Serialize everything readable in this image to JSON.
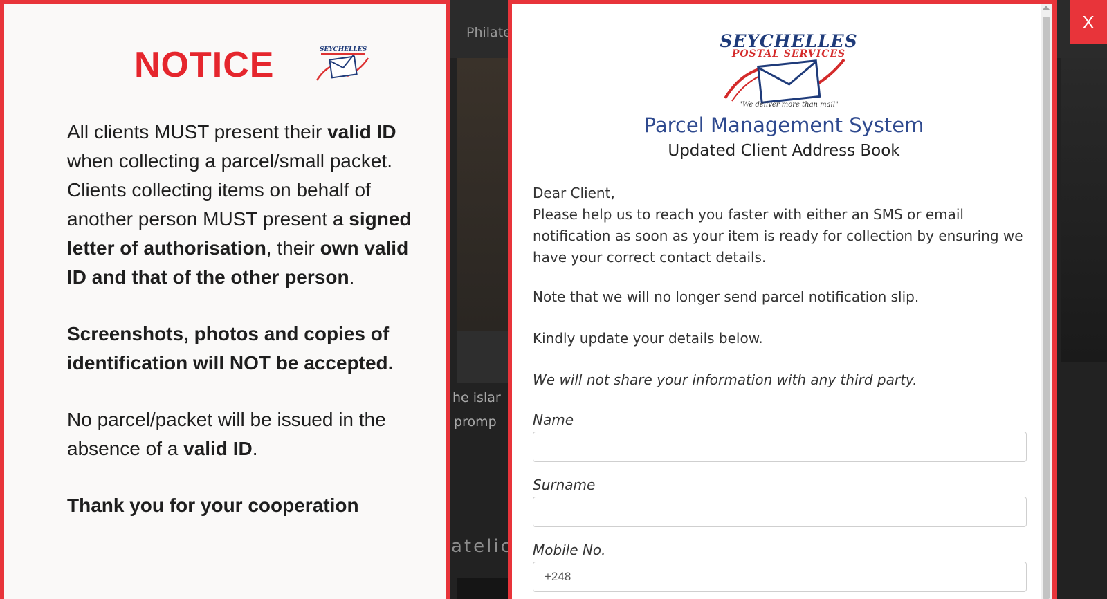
{
  "background": {
    "nav_link": "Philate",
    "text_fragments": [
      "he islar",
      "promp",
      "atelic"
    ]
  },
  "notice": {
    "title": "NOTICE",
    "mini_logo_text": "SEYCHELLES",
    "p1": {
      "t1": "All clients MUST present their ",
      "b1": "valid ID",
      "t2": " when collecting a parcel/small packet."
    },
    "p2": {
      "t1": "Clients collecting items on behalf of another person MUST present a ",
      "b1": "signed letter of authorisation",
      "t2": ", their ",
      "b2": "own valid ID and that of the other person",
      "t3": "."
    },
    "p3": "Screenshots, photos and copies of identification will NOT be accepted.",
    "p4": {
      "t1": "No parcel/packet will be issued in the absence of a ",
      "b1": "valid ID",
      "t2": "."
    },
    "p5": "Thank you for your cooperation"
  },
  "form": {
    "logo": {
      "line1": "SEYCHELLES",
      "line2": "POSTAL SERVICES",
      "tagline": "\"We deliver more than mail\""
    },
    "title": "Parcel Management System",
    "subtitle": "Updated Client Address Book",
    "greeting": "Dear Client,",
    "intro": "Please help us to reach you faster with either an SMS or email notification as soon as your item is ready for collection by ensuring we have your correct contact details.",
    "note": "Note that we will no longer send parcel notification slip.",
    "update": "Kindly update your details below.",
    "privacy": "We will not share your information with any third party.",
    "fields": {
      "name": {
        "label": "Name",
        "value": ""
      },
      "surname": {
        "label": "Surname",
        "value": ""
      },
      "mobile": {
        "label": "Mobile No.",
        "value": "+248"
      }
    }
  },
  "close_label": "X",
  "colors": {
    "accent_red": "#e8343a",
    "title_blue": "#2f4a8f"
  }
}
